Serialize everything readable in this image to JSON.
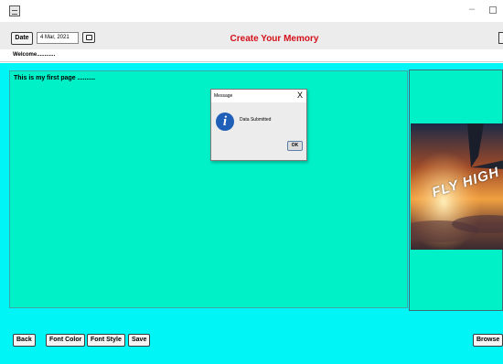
{
  "window": {
    "minimize_glyph": "–"
  },
  "header": {
    "date_label": "Date",
    "date_value": "4 Mar, 2021",
    "title": "Create Your Memory",
    "title_color": "#d4101a"
  },
  "welcome": "Welcome............",
  "editor": {
    "text": "This is my first page ..........",
    "background": "#00f0c8"
  },
  "image_panel": {
    "caption": "FLY HIGH"
  },
  "dialog": {
    "title": "Message",
    "close": "X",
    "message": "Data Submitted",
    "ok_label": "OK",
    "icon": "info-icon"
  },
  "buttons": {
    "back": "Back",
    "font_color": "Font Color",
    "font_style": "Font Style",
    "save": "Save",
    "browse": "Browse"
  },
  "colors": {
    "workspace": "#00f6f6",
    "accent": "#1f5fb8"
  }
}
